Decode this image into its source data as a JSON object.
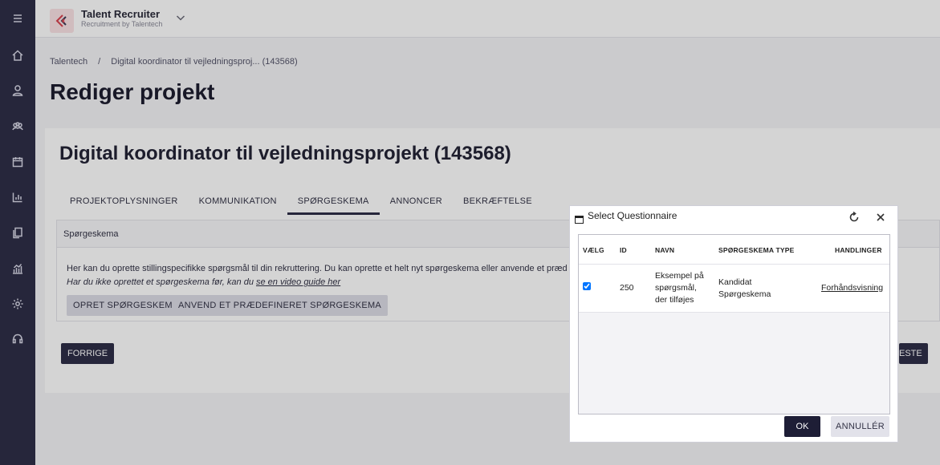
{
  "app": {
    "title": "Talent Recruiter",
    "subtitle": "Recruitment by Talentech"
  },
  "sidebar": {
    "icons": [
      "menu-icon",
      "home-icon",
      "user-icon",
      "users-icon",
      "calendar-icon",
      "bar-chart-icon",
      "documents-icon",
      "analytics-icon",
      "settings-icon",
      "support-icon"
    ]
  },
  "breadcrumb": {
    "root": "Talentech",
    "separator": "/",
    "current": "Digital koordinator til vejledningsproj... (143568)"
  },
  "page": {
    "title": "Rediger projekt"
  },
  "project": {
    "title": "Digital koordinator til vejledningsprojekt (143568)",
    "tabs": [
      {
        "label": "PROJEKTOPLYSNINGER",
        "active": false
      },
      {
        "label": "KOMMUNIKATION",
        "active": false
      },
      {
        "label": "SPØRGESKEMA",
        "active": true
      },
      {
        "label": "ANNONCER",
        "active": false
      },
      {
        "label": "BEKRÆFTELSE",
        "active": false
      }
    ],
    "section": {
      "heading": "Spørgeskema",
      "text": "Her kan du oprette stillingspecifikke spørgsmål til din rekruttering. Du kan oprette et helt nyt spørgeskema eller anvende et præd",
      "hint_prefix": "Har du ikke oprettet et spørgeskema før, kan du ",
      "hint_link": "se en video guide her",
      "create_button": "OPRET SPØRGESKEMA",
      "apply_button": "ANVEND ET PRÆDEFINERET SPØRGESKEMA"
    },
    "prev_button": "FORRIGE",
    "next_button": "ESTE"
  },
  "dialog": {
    "title": "Select Questionnaire",
    "columns": {
      "select": "VÆLG",
      "id": "ID",
      "name": "NAVN",
      "type": "SPØRGESKEMA TYPE",
      "actions": "HANDLINGER"
    },
    "rows": [
      {
        "checked": true,
        "id": "250",
        "name_lines": [
          "Eksempel på",
          "spørgsmål,",
          "der tilføjes"
        ],
        "type_lines": [
          "Kandidat",
          "Spørgeskema"
        ],
        "action": "Forhåndsvisning"
      }
    ],
    "ok_button": "OK",
    "cancel_button": "ANNULLÉR"
  },
  "colors": {
    "sidebar": "#2e2e48",
    "primary": "#2e2e48",
    "logo_bg": "#fbe3e5",
    "logo_accent": "#d9434f"
  }
}
